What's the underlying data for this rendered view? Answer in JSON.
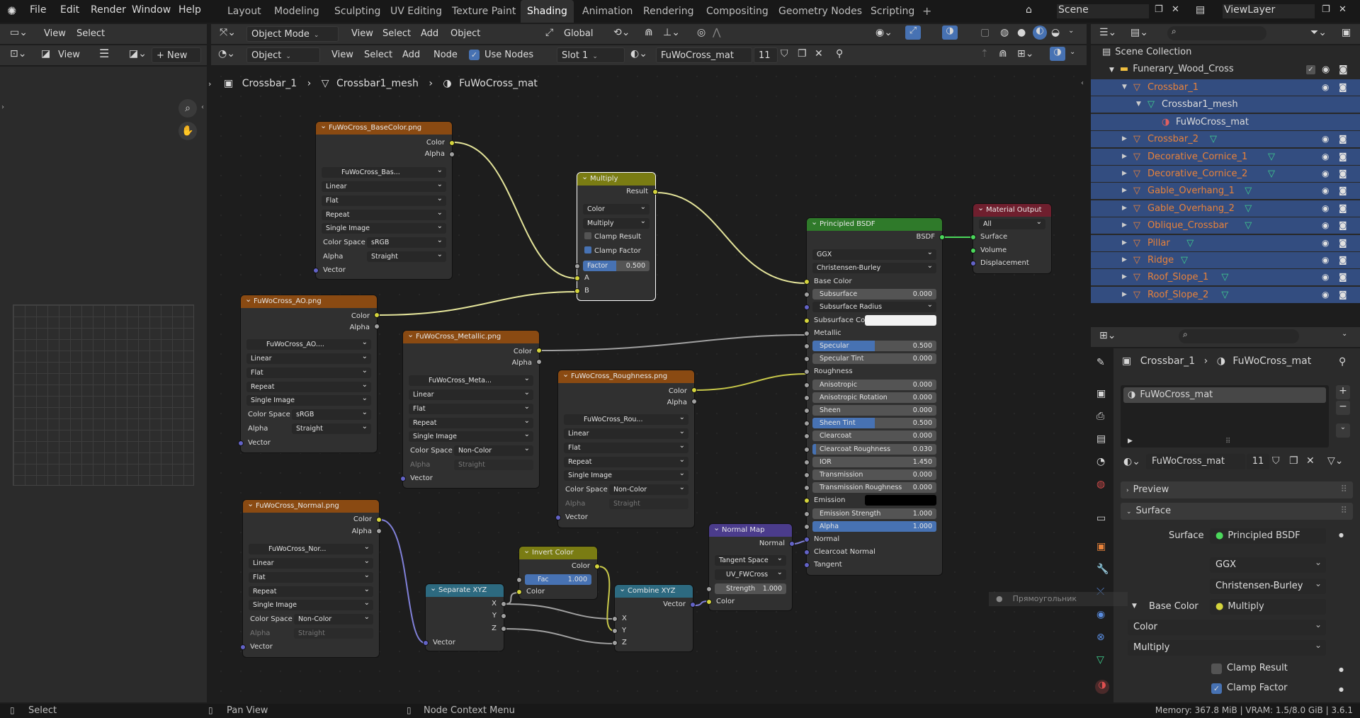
{
  "app": {
    "logo": "blender-logo"
  },
  "menus": [
    "File",
    "Edit",
    "Render",
    "Window",
    "Help"
  ],
  "workspaces": [
    "Layout",
    "Modeling",
    "Sculpting",
    "UV Editing",
    "Texture Paint",
    "Shading",
    "Animation",
    "Rendering",
    "Compositing",
    "Geometry Nodes",
    "Scripting"
  ],
  "active_workspace": "Shading",
  "scene": "Scene",
  "view_layer": "ViewLayer",
  "viewport_header": {
    "mode": "Object Mode",
    "view": "View",
    "select": "Select",
    "add": "Add",
    "object": "Object",
    "orientation": "Global"
  },
  "left_header": {
    "view": "View",
    "select": "Select"
  },
  "image_header": {
    "view": "View",
    "new": "New"
  },
  "node_header": {
    "type": "Object",
    "view": "View",
    "select": "Select",
    "add": "Add",
    "node": "Node",
    "use_nodes": "Use Nodes",
    "slot": "Slot 1",
    "material": "FuWoCross_mat",
    "users": "11"
  },
  "breadcrumb": {
    "object": "Crossbar_1",
    "mesh": "Crossbar1_mesh",
    "material": "FuWoCross_mat"
  },
  "nodes": {
    "basecolor": {
      "title": "FuWoCross_BaseColor.png",
      "out1": "Color",
      "out2": "Alpha",
      "img": "FuWoCross_Bas...",
      "interp": "Linear",
      "proj": "Flat",
      "ext": "Repeat",
      "src": "Single Image",
      "cs_label": "Color Space",
      "cs": "sRGB",
      "alpha_label": "Alpha",
      "alpha": "Straight",
      "in": "Vector"
    },
    "ao": {
      "title": "FuWoCross_AO.png",
      "out1": "Color",
      "out2": "Alpha",
      "img": "FuWoCross_AO....",
      "interp": "Linear",
      "proj": "Flat",
      "ext": "Repeat",
      "src": "Single Image",
      "cs_label": "Color Space",
      "cs": "sRGB",
      "alpha_label": "Alpha",
      "alpha": "Straight",
      "in": "Vector"
    },
    "metallic": {
      "title": "FuWoCross_Metallic.png",
      "out1": "Color",
      "out2": "Alpha",
      "img": "FuWoCross_Meta...",
      "interp": "Linear",
      "proj": "Flat",
      "ext": "Repeat",
      "src": "Single Image",
      "cs_label": "Color Space",
      "cs": "Non-Color",
      "alpha_label": "Alpha",
      "alpha": "Straight",
      "in": "Vector"
    },
    "roughness": {
      "title": "FuWoCross_Roughness.png",
      "out1": "Color",
      "out2": "Alpha",
      "img": "FuWoCross_Rou...",
      "interp": "Linear",
      "proj": "Flat",
      "ext": "Repeat",
      "src": "Single Image",
      "cs_label": "Color Space",
      "cs": "Non-Color",
      "alpha_label": "Alpha",
      "alpha": "Straight",
      "in": "Vector"
    },
    "normalimg": {
      "title": "FuWoCross_Normal.png",
      "out1": "Color",
      "out2": "Alpha",
      "img": "FuWoCross_Nor...",
      "interp": "Linear",
      "proj": "Flat",
      "ext": "Repeat",
      "src": "Single Image",
      "cs_label": "Color Space",
      "cs": "Non-Color",
      "alpha_label": "Alpha",
      "alpha": "Straight",
      "in": "Vector"
    },
    "multiply": {
      "title": "Multiply",
      "out": "Result",
      "type": "Color",
      "blend": "Multiply",
      "clamp_result": "Clamp Result",
      "clamp_factor": "Clamp Factor",
      "factor_label": "Factor",
      "factor": "0.500",
      "factor_fill": 0.5,
      "a": "A",
      "b": "B"
    },
    "separate": {
      "title": "Separate XYZ",
      "x": "X",
      "y": "Y",
      "z": "Z",
      "in": "Vector"
    },
    "invert": {
      "title": "Invert Color",
      "out": "Color",
      "fac_label": "Fac",
      "fac": "1.000",
      "in": "Color"
    },
    "combine": {
      "title": "Combine XYZ",
      "out": "Vector",
      "x": "X",
      "y": "Y",
      "z": "Z"
    },
    "normalmap": {
      "title": "Normal Map",
      "out": "Normal",
      "space": "Tangent Space",
      "uv": "UV_FWCross",
      "strength_label": "Strength",
      "strength": "1.000",
      "in": "Color"
    },
    "bsdf": {
      "title": "Principled BSDF",
      "out": "BSDF",
      "dist": "GGX",
      "sss": "Christensen-Burley",
      "rows": [
        {
          "label": "Base Color",
          "kind": "socket"
        },
        {
          "label": "Subsurface",
          "kind": "value",
          "value": "0.000",
          "fill": 0
        },
        {
          "label": "Subsurface Radius",
          "kind": "dropdown"
        },
        {
          "label": "Subsurface Color",
          "kind": "color"
        },
        {
          "label": "Metallic",
          "kind": "socket"
        },
        {
          "label": "Specular",
          "kind": "value",
          "value": "0.500",
          "fill": 0.5
        },
        {
          "label": "Specular Tint",
          "kind": "value",
          "value": "0.000",
          "fill": 0
        },
        {
          "label": "Roughness",
          "kind": "socket"
        },
        {
          "label": "Anisotropic",
          "kind": "value",
          "value": "0.000",
          "fill": 0
        },
        {
          "label": "Anisotropic Rotation",
          "kind": "value",
          "value": "0.000",
          "fill": 0
        },
        {
          "label": "Sheen",
          "kind": "value",
          "value": "0.000",
          "fill": 0
        },
        {
          "label": "Sheen Tint",
          "kind": "value",
          "value": "0.500",
          "fill": 0.5
        },
        {
          "label": "Clearcoat",
          "kind": "value",
          "value": "0.000",
          "fill": 0
        },
        {
          "label": "Clearcoat Roughness",
          "kind": "value",
          "value": "0.030",
          "fill": 0.03
        },
        {
          "label": "IOR",
          "kind": "value",
          "value": "1.450",
          "fill": 0
        },
        {
          "label": "Transmission",
          "kind": "value",
          "value": "0.000",
          "fill": 0
        },
        {
          "label": "Transmission Roughness",
          "kind": "value",
          "value": "0.000",
          "fill": 0
        },
        {
          "label": "Emission",
          "kind": "emission"
        },
        {
          "label": "Emission Strength",
          "kind": "value",
          "value": "1.000",
          "fill": 0
        },
        {
          "label": "Alpha",
          "kind": "value",
          "value": "1.000",
          "fill": 1
        },
        {
          "label": "Normal",
          "kind": "socket"
        },
        {
          "label": "Clearcoat Normal",
          "kind": "socket"
        },
        {
          "label": "Tangent",
          "kind": "socket"
        }
      ]
    },
    "output": {
      "title": "Material Output",
      "target": "All",
      "surface": "Surface",
      "volume": "Volume",
      "displacement": "Displacement"
    }
  },
  "outliner": {
    "root": "Scene Collection",
    "collection": "Funerary_Wood_Cross",
    "items": [
      {
        "name": "Crossbar_1",
        "level": 2,
        "kind": "object",
        "selected": true,
        "expanded": true
      },
      {
        "name": "Crossbar1_mesh",
        "level": 3,
        "kind": "mesh",
        "selected": true
      },
      {
        "name": "FuWoCross_mat",
        "level": 4,
        "kind": "material",
        "selected": true
      },
      {
        "name": "Crossbar_2",
        "level": 2,
        "kind": "object",
        "selected": true
      },
      {
        "name": "Decorative_Cornice_1",
        "level": 2,
        "kind": "object",
        "selected": true
      },
      {
        "name": "Decorative_Cornice_2",
        "level": 2,
        "kind": "object",
        "selected": true
      },
      {
        "name": "Gable_Overhang_1",
        "level": 2,
        "kind": "object",
        "selected": true
      },
      {
        "name": "Gable_Overhang_2",
        "level": 2,
        "kind": "object",
        "selected": true
      },
      {
        "name": "Oblique_Crossbar",
        "level": 2,
        "kind": "object",
        "selected": true
      },
      {
        "name": "Pillar",
        "level": 2,
        "kind": "object",
        "selected": true
      },
      {
        "name": "Ridge",
        "level": 2,
        "kind": "object",
        "selected": true
      },
      {
        "name": "Roof_Slope_1",
        "level": 2,
        "kind": "object",
        "selected": true
      },
      {
        "name": "Roof_Slope_2",
        "level": 2,
        "kind": "object",
        "selected": true
      }
    ]
  },
  "properties": {
    "object": "Crossbar_1",
    "material": "FuWoCross_mat",
    "slot_name": "FuWoCross_mat",
    "mat_field": "FuWoCross_mat",
    "users": "11",
    "preview": "Preview",
    "surface_panel": "Surface",
    "surface_label": "Surface",
    "surface_value": "Principled BSDF",
    "dist": "GGX",
    "sss": "Christensen-Burley",
    "base_color_label": "Base Color",
    "base_color_value": "Multiply",
    "mix_type": "Color",
    "mix_blend": "Multiply",
    "clamp_result": "Clamp Result",
    "clamp_factor": "Clamp Factor",
    "tooltip": "Прямоугольник"
  },
  "status": {
    "left": "Select",
    "mid": "Pan View",
    "right": "Node Context Menu",
    "info": "Memory: 367.8 MiB | VRAM: 1.5/8.0 GiB | 3.6.1"
  },
  "colors": {
    "accent": "#4772b3",
    "object": "#e8823a",
    "texture_header": "#8a4a12",
    "shader_header": "#2f7a2a"
  }
}
